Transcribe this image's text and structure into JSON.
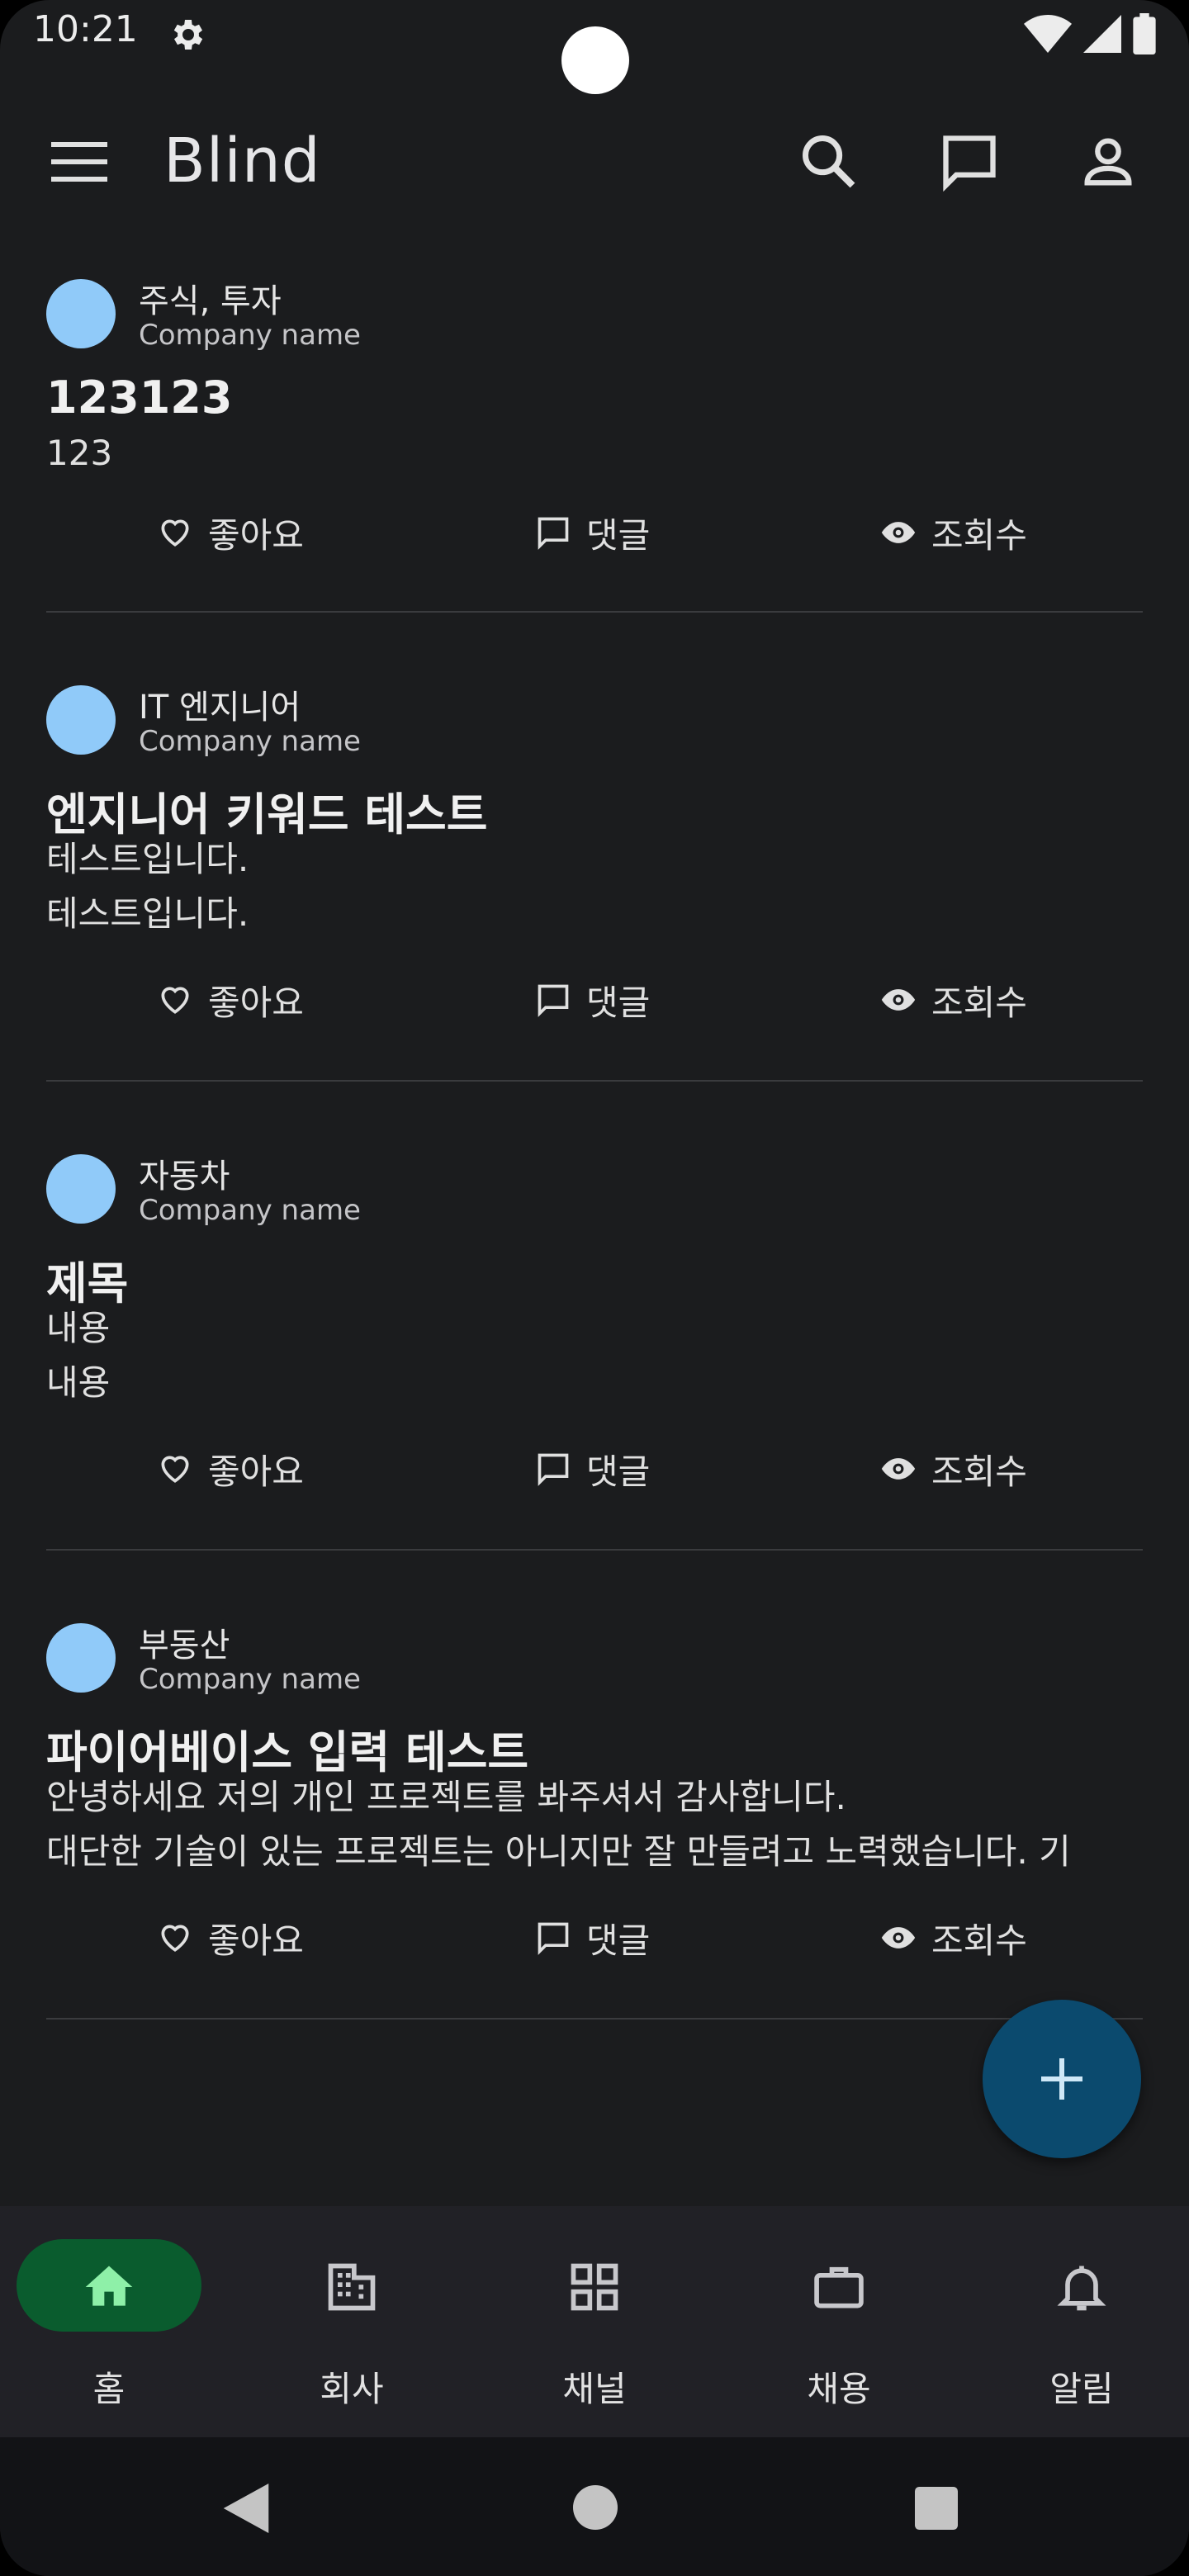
{
  "status_bar": {
    "time": "10:21"
  },
  "app_bar": {
    "title": "Blind"
  },
  "posts": [
    {
      "category": "주식, 투자",
      "company": "Company name",
      "title": "123123",
      "body": [
        "123"
      ],
      "like_label": "좋아요",
      "comment_label": "댓글",
      "view_label": "조회수"
    },
    {
      "category": "IT 엔지니어",
      "company": "Company name",
      "title": "엔지니어 키워드 테스트",
      "body": [
        "테스트입니다.",
        "테스트입니다."
      ],
      "like_label": "좋아요",
      "comment_label": "댓글",
      "view_label": "조회수"
    },
    {
      "category": "자동차",
      "company": "Company name",
      "title": "제목",
      "body": [
        "내용",
        "내용"
      ],
      "like_label": "좋아요",
      "comment_label": "댓글",
      "view_label": "조회수"
    },
    {
      "category": "부동산",
      "company": "Company name",
      "title": "파이어베이스 입력 테스트",
      "body": [
        "안녕하세요 저의 개인 프로젝트를 봐주셔서 감사합니다.",
        "대단한 기술이 있는 프로젝트는 아니지만 잘 만들려고 노력했습니다. 기"
      ],
      "like_label": "좋아요",
      "comment_label": "댓글",
      "view_label": "조회수"
    }
  ],
  "bottom_nav": {
    "items": [
      {
        "label": "홈",
        "icon": "home-icon",
        "active": true
      },
      {
        "label": "회사",
        "icon": "building-icon",
        "active": false
      },
      {
        "label": "채널",
        "icon": "grid-icon",
        "active": false
      },
      {
        "label": "채용",
        "icon": "briefcase-icon",
        "active": false
      },
      {
        "label": "알림",
        "icon": "bell-icon",
        "active": false
      }
    ]
  },
  "colors": {
    "background": "#1b1c1e",
    "avatar": "#90caf9",
    "fab": "#0b4a6e",
    "active_nav_pill": "#0a5c2e",
    "active_nav_icon": "#8ef0a8"
  }
}
